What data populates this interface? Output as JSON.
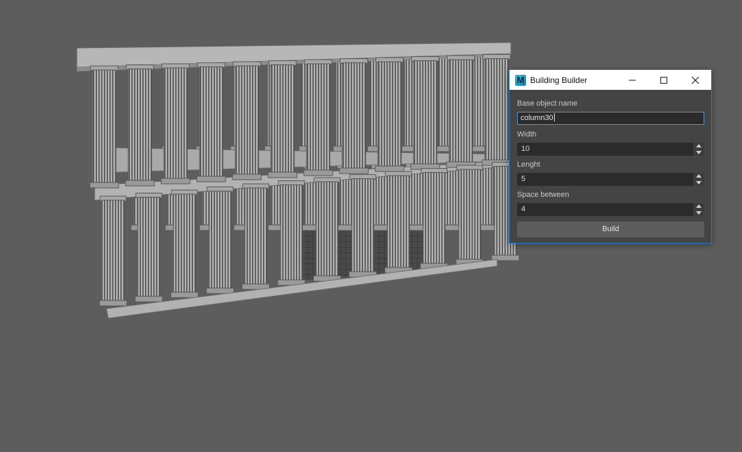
{
  "window": {
    "title": "Building Builder",
    "logo_letter": "M",
    "controls": [
      "minimize-icon",
      "maximize-icon",
      "close-icon"
    ]
  },
  "form": {
    "base_object_label": "Base object name",
    "base_object_value": "column30",
    "width_label": "Width",
    "width_value": "10",
    "length_label": "Lenght",
    "length_value": "5",
    "space_label": "Space between",
    "space_value": "4",
    "build_label": "Build"
  },
  "colors": {
    "viewport_bg": "#5d5d5d",
    "dialog_bg": "#444444",
    "field_bg": "#2b2b2b",
    "focus_border": "#5796d2",
    "accent_border": "#2c79c8"
  }
}
